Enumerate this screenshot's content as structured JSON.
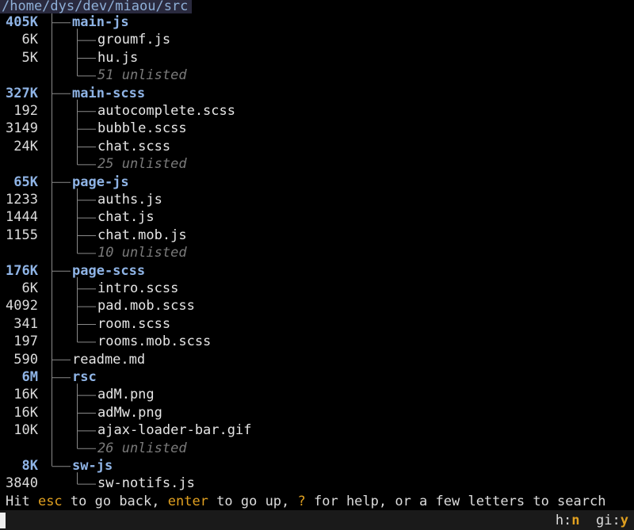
{
  "root_path": "/home/dys/dev/miaou/src",
  "tree": [
    {
      "size": "405K",
      "name": "main-js",
      "kind": "dir",
      "depth": 1
    },
    {
      "size": "6K",
      "name": "groumf.js",
      "kind": "file",
      "depth": 2
    },
    {
      "size": "5K",
      "name": "hu.js",
      "kind": "file",
      "depth": 2
    },
    {
      "size": "",
      "name": "51 unlisted",
      "kind": "unlisted",
      "depth": 2
    },
    {
      "size": "327K",
      "name": "main-scss",
      "kind": "dir",
      "depth": 1
    },
    {
      "size": "192",
      "name": "autocomplete.scss",
      "kind": "file",
      "depth": 2
    },
    {
      "size": "3149",
      "name": "bubble.scss",
      "kind": "file",
      "depth": 2
    },
    {
      "size": "24K",
      "name": "chat.scss",
      "kind": "file",
      "depth": 2
    },
    {
      "size": "",
      "name": "25 unlisted",
      "kind": "unlisted",
      "depth": 2
    },
    {
      "size": "65K",
      "name": "page-js",
      "kind": "dir",
      "depth": 1
    },
    {
      "size": "1233",
      "name": "auths.js",
      "kind": "file",
      "depth": 2
    },
    {
      "size": "1444",
      "name": "chat.js",
      "kind": "file",
      "depth": 2
    },
    {
      "size": "1155",
      "name": "chat.mob.js",
      "kind": "file",
      "depth": 2
    },
    {
      "size": "",
      "name": "10 unlisted",
      "kind": "unlisted",
      "depth": 2
    },
    {
      "size": "176K",
      "name": "page-scss",
      "kind": "dir",
      "depth": 1
    },
    {
      "size": "6K",
      "name": "intro.scss",
      "kind": "file",
      "depth": 2
    },
    {
      "size": "4092",
      "name": "pad.mob.scss",
      "kind": "file",
      "depth": 2
    },
    {
      "size": "341",
      "name": "room.scss",
      "kind": "file",
      "depth": 2
    },
    {
      "size": "197",
      "name": "rooms.mob.scss",
      "kind": "file",
      "depth": 2
    },
    {
      "size": "590",
      "name": "readme.md",
      "kind": "file",
      "depth": 1
    },
    {
      "size": "6M",
      "name": "rsc",
      "kind": "dir",
      "depth": 1
    },
    {
      "size": "16K",
      "name": "adM.png",
      "kind": "file",
      "depth": 2
    },
    {
      "size": "16K",
      "name": "adMw.png",
      "kind": "file",
      "depth": 2
    },
    {
      "size": "10K",
      "name": "ajax-loader-bar.gif",
      "kind": "file",
      "depth": 2
    },
    {
      "size": "",
      "name": "26 unlisted",
      "kind": "unlisted",
      "depth": 2
    },
    {
      "size": "8K",
      "name": "sw-js",
      "kind": "dir",
      "depth": 1
    },
    {
      "size": "3840",
      "name": "sw-notifs.js",
      "kind": "file",
      "depth": 2
    }
  ],
  "status": {
    "t1": "Hit ",
    "k1": "esc",
    "t2": " to go back, ",
    "k2": "enter",
    "t3": " to go up, ",
    "k3": "?",
    "t4": " for help, or a few letters to search"
  },
  "flags": {
    "h_label": "h:",
    "h_value": "n",
    "gi_label": "gi:",
    "gi_value": "y"
  },
  "colors": {
    "background": "#000000",
    "directory": "#8fb4e6",
    "key_highlight": "#e0a020",
    "unlisted": "#7a7a7a"
  }
}
